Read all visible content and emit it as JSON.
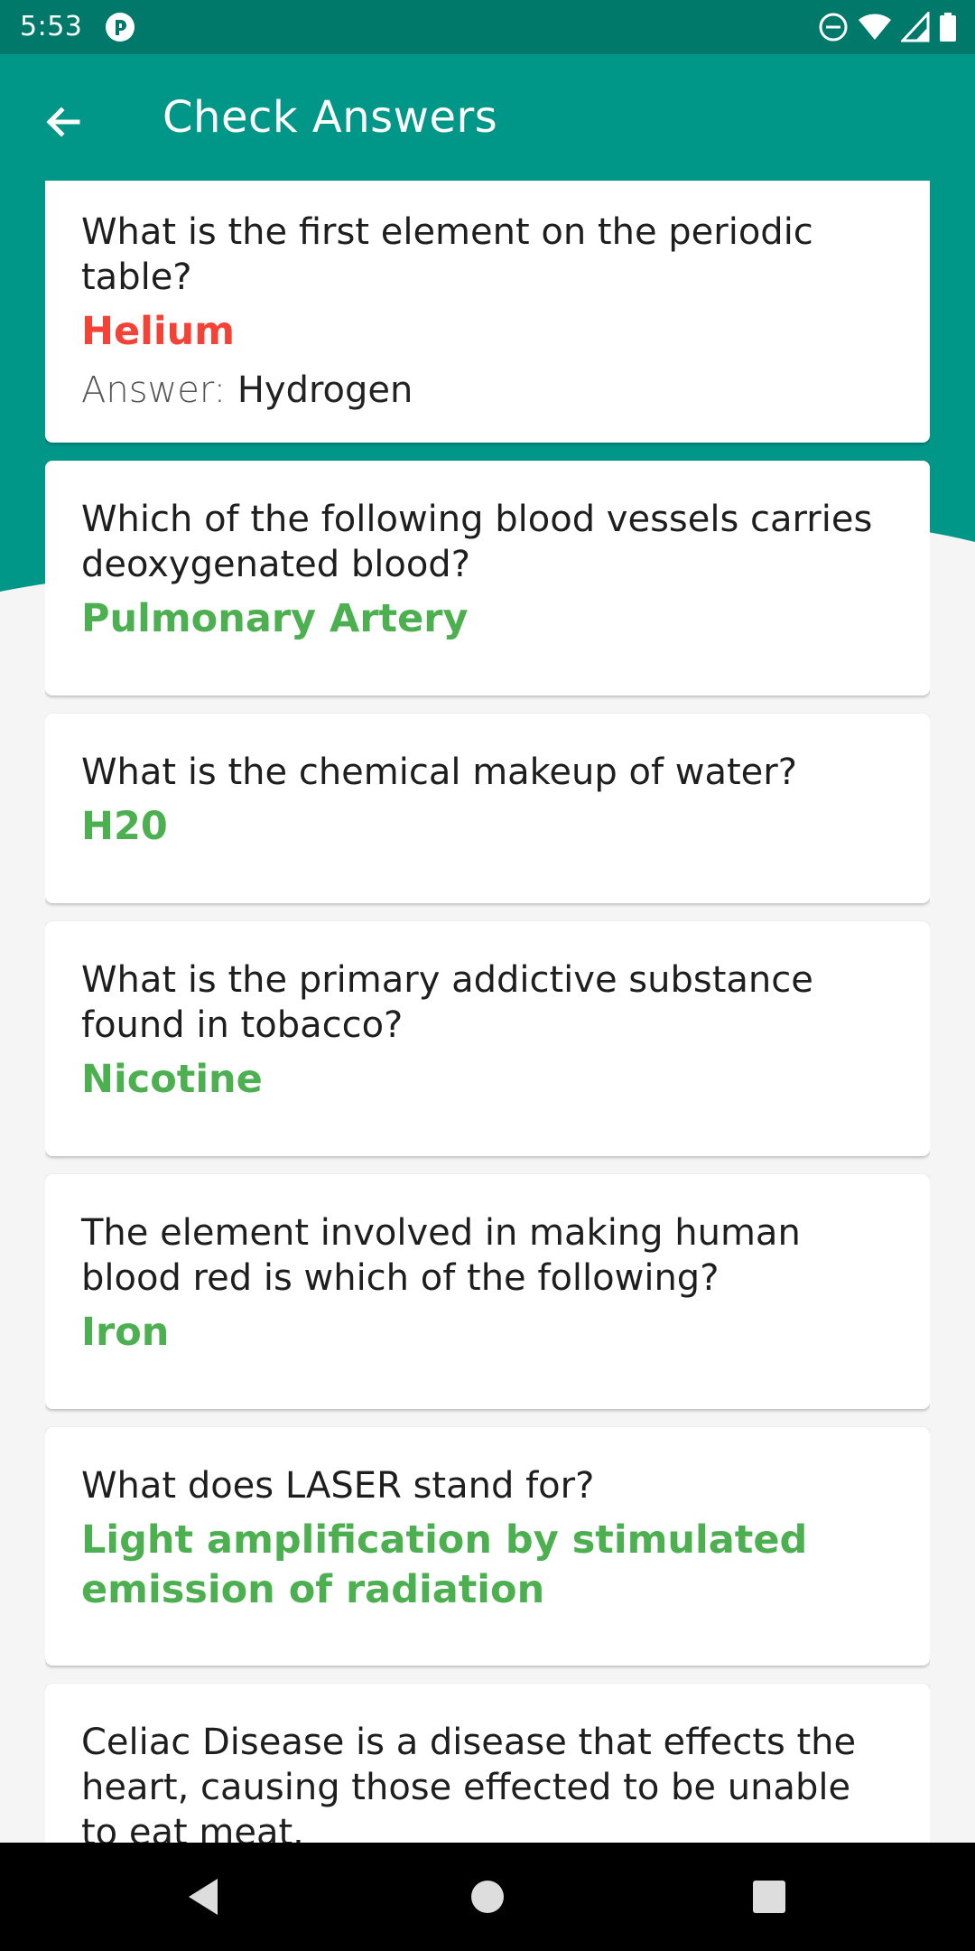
{
  "status_bar": {
    "time": "5:53"
  },
  "app_bar": {
    "title": "Check Answers"
  },
  "cards": [
    {
      "question": "What is the first element on the periodic table?",
      "answer": "Helium",
      "correct_prefix": "Answer:",
      "correct_answer": "Hydrogen"
    },
    {
      "question": "Which of the following blood vessels carries deoxygenated blood?",
      "answer": "Pulmonary Artery"
    },
    {
      "question": "What is the chemical makeup of water?",
      "answer": "H20"
    },
    {
      "question": "What is the primary addictive substance found in tobacco?",
      "answer": "Nicotine"
    },
    {
      "question": "The element involved in making human blood red is which of the following?",
      "answer": "Iron"
    },
    {
      "question": "What does LASER stand for?",
      "answer": "Light amplification by stimulated emission of radiation"
    },
    {
      "question": "Celiac Disease is a disease that effects the heart, causing those effected to be unable to eat meat.",
      "answer": ""
    }
  ],
  "colors": {
    "primary": "#009688",
    "primary_dark": "#00796b",
    "correct": "#4caf50",
    "wrong": "#f44336"
  },
  "icons": {
    "back": "arrow-left-icon",
    "nav_back": "triangle-back-icon",
    "nav_home": "circle-home-icon",
    "nav_recents": "square-recents-icon"
  }
}
